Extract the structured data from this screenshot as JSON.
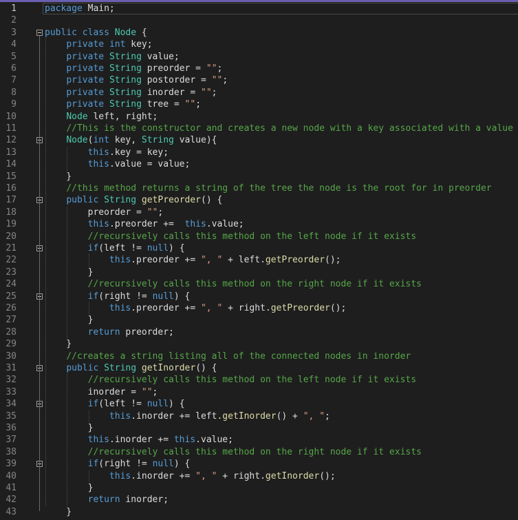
{
  "editor": {
    "current_line": 1,
    "lines": [
      {
        "n": "1",
        "fold": false,
        "tokens": [
          [
            "k",
            "package"
          ],
          [
            "p",
            " Main;"
          ]
        ]
      },
      {
        "n": "2",
        "fold": false,
        "tokens": []
      },
      {
        "n": "3",
        "fold": true,
        "tokens": [
          [
            "k",
            "public"
          ],
          [
            "p",
            " "
          ],
          [
            "k",
            "class"
          ],
          [
            "p",
            " "
          ],
          [
            "t",
            "Node"
          ],
          [
            "p",
            " {"
          ]
        ]
      },
      {
        "n": "4",
        "fold": false,
        "tokens": [
          [
            "p",
            "    "
          ],
          [
            "k",
            "private"
          ],
          [
            "p",
            " "
          ],
          [
            "k",
            "int"
          ],
          [
            "p",
            " key;"
          ]
        ]
      },
      {
        "n": "5",
        "fold": false,
        "tokens": [
          [
            "p",
            "    "
          ],
          [
            "k",
            "private"
          ],
          [
            "p",
            " "
          ],
          [
            "t",
            "String"
          ],
          [
            "p",
            " value;"
          ]
        ]
      },
      {
        "n": "6",
        "fold": false,
        "tokens": [
          [
            "p",
            "    "
          ],
          [
            "k",
            "private"
          ],
          [
            "p",
            " "
          ],
          [
            "t",
            "String"
          ],
          [
            "p",
            " preorder = "
          ],
          [
            "s",
            "\"\""
          ],
          [
            "p",
            ";"
          ]
        ]
      },
      {
        "n": "7",
        "fold": false,
        "tokens": [
          [
            "p",
            "    "
          ],
          [
            "k",
            "private"
          ],
          [
            "p",
            " "
          ],
          [
            "t",
            "String"
          ],
          [
            "p",
            " postorder = "
          ],
          [
            "s",
            "\"\""
          ],
          [
            "p",
            ";"
          ]
        ]
      },
      {
        "n": "8",
        "fold": false,
        "tokens": [
          [
            "p",
            "    "
          ],
          [
            "k",
            "private"
          ],
          [
            "p",
            " "
          ],
          [
            "t",
            "String"
          ],
          [
            "p",
            " inorder = "
          ],
          [
            "s",
            "\"\""
          ],
          [
            "p",
            ";"
          ]
        ]
      },
      {
        "n": "9",
        "fold": false,
        "tokens": [
          [
            "p",
            "    "
          ],
          [
            "k",
            "private"
          ],
          [
            "p",
            " "
          ],
          [
            "t",
            "String"
          ],
          [
            "p",
            " tree = "
          ],
          [
            "s",
            "\"\""
          ],
          [
            "p",
            ";"
          ]
        ]
      },
      {
        "n": "10",
        "fold": false,
        "tokens": [
          [
            "p",
            "    "
          ],
          [
            "t",
            "Node"
          ],
          [
            "p",
            " left, right;"
          ]
        ]
      },
      {
        "n": "11",
        "fold": false,
        "tokens": [
          [
            "p",
            "    "
          ],
          [
            "c",
            "//This is the constructor and creates a new node with a key associated with a value"
          ]
        ]
      },
      {
        "n": "12",
        "fold": true,
        "tokens": [
          [
            "p",
            "    "
          ],
          [
            "t",
            "Node"
          ],
          [
            "p",
            "("
          ],
          [
            "k",
            "int"
          ],
          [
            "p",
            " key, "
          ],
          [
            "t",
            "String"
          ],
          [
            "p",
            " value){"
          ]
        ]
      },
      {
        "n": "13",
        "fold": false,
        "tokens": [
          [
            "p",
            "        "
          ],
          [
            "k",
            "this"
          ],
          [
            "p",
            ".key = key;"
          ]
        ]
      },
      {
        "n": "14",
        "fold": false,
        "tokens": [
          [
            "p",
            "        "
          ],
          [
            "k",
            "this"
          ],
          [
            "p",
            ".value = value;"
          ]
        ]
      },
      {
        "n": "15",
        "fold": false,
        "tokens": [
          [
            "p",
            "    }"
          ]
        ]
      },
      {
        "n": "16",
        "fold": false,
        "tokens": [
          [
            "p",
            "    "
          ],
          [
            "c",
            "//this method returns a string of the tree the node is the root for in preorder"
          ]
        ]
      },
      {
        "n": "17",
        "fold": true,
        "tokens": [
          [
            "p",
            "    "
          ],
          [
            "k",
            "public"
          ],
          [
            "p",
            " "
          ],
          [
            "t",
            "String"
          ],
          [
            "p",
            " "
          ],
          [
            "m",
            "getPreorder"
          ],
          [
            "p",
            "() {"
          ]
        ]
      },
      {
        "n": "18",
        "fold": false,
        "tokens": [
          [
            "p",
            "        preorder = "
          ],
          [
            "s",
            "\"\""
          ],
          [
            "p",
            ";"
          ]
        ]
      },
      {
        "n": "19",
        "fold": false,
        "tokens": [
          [
            "p",
            "        "
          ],
          [
            "k",
            "this"
          ],
          [
            "p",
            ".preorder +=  "
          ],
          [
            "k",
            "this"
          ],
          [
            "p",
            ".value;"
          ]
        ]
      },
      {
        "n": "20",
        "fold": false,
        "tokens": [
          [
            "p",
            "        "
          ],
          [
            "c",
            "//recursively calls this method on the left node if it exists"
          ]
        ]
      },
      {
        "n": "21",
        "fold": true,
        "tokens": [
          [
            "p",
            "        "
          ],
          [
            "k",
            "if"
          ],
          [
            "p",
            "(left != "
          ],
          [
            "k",
            "null"
          ],
          [
            "p",
            ") {"
          ]
        ]
      },
      {
        "n": "22",
        "fold": false,
        "tokens": [
          [
            "p",
            "            "
          ],
          [
            "k",
            "this"
          ],
          [
            "p",
            ".preorder += "
          ],
          [
            "s",
            "\", \""
          ],
          [
            "p",
            " + left."
          ],
          [
            "m",
            "getPreorder"
          ],
          [
            "p",
            "();"
          ]
        ]
      },
      {
        "n": "23",
        "fold": false,
        "tokens": [
          [
            "p",
            "        }"
          ]
        ]
      },
      {
        "n": "24",
        "fold": false,
        "tokens": [
          [
            "p",
            "        "
          ],
          [
            "c",
            "//recursively calls this method on the right node if it exists"
          ]
        ]
      },
      {
        "n": "25",
        "fold": true,
        "tokens": [
          [
            "p",
            "        "
          ],
          [
            "k",
            "if"
          ],
          [
            "p",
            "(right != "
          ],
          [
            "k",
            "null"
          ],
          [
            "p",
            ") {"
          ]
        ]
      },
      {
        "n": "26",
        "fold": false,
        "tokens": [
          [
            "p",
            "            "
          ],
          [
            "k",
            "this"
          ],
          [
            "p",
            ".preorder += "
          ],
          [
            "s",
            "\", \""
          ],
          [
            "p",
            " + right."
          ],
          [
            "m",
            "getPreorder"
          ],
          [
            "p",
            "();"
          ]
        ]
      },
      {
        "n": "27",
        "fold": false,
        "tokens": [
          [
            "p",
            "        }"
          ]
        ]
      },
      {
        "n": "28",
        "fold": false,
        "tokens": [
          [
            "p",
            "        "
          ],
          [
            "k",
            "return"
          ],
          [
            "p",
            " preorder;"
          ]
        ]
      },
      {
        "n": "29",
        "fold": false,
        "tokens": [
          [
            "p",
            "    }"
          ]
        ]
      },
      {
        "n": "30",
        "fold": false,
        "tokens": [
          [
            "p",
            "    "
          ],
          [
            "c",
            "//creates a string listing all of the connected nodes in inorder"
          ]
        ]
      },
      {
        "n": "31",
        "fold": true,
        "tokens": [
          [
            "p",
            "    "
          ],
          [
            "k",
            "public"
          ],
          [
            "p",
            " "
          ],
          [
            "t",
            "String"
          ],
          [
            "p",
            " "
          ],
          [
            "m",
            "getInorder"
          ],
          [
            "p",
            "() {"
          ]
        ]
      },
      {
        "n": "32",
        "fold": false,
        "tokens": [
          [
            "p",
            "        "
          ],
          [
            "c",
            "//recursively calls this method on the left node if it exists"
          ]
        ]
      },
      {
        "n": "33",
        "fold": false,
        "tokens": [
          [
            "p",
            "        inorder = "
          ],
          [
            "s",
            "\"\""
          ],
          [
            "p",
            ";"
          ]
        ]
      },
      {
        "n": "34",
        "fold": true,
        "tokens": [
          [
            "p",
            "        "
          ],
          [
            "k",
            "if"
          ],
          [
            "p",
            "(left != "
          ],
          [
            "k",
            "null"
          ],
          [
            "p",
            ") {"
          ]
        ]
      },
      {
        "n": "35",
        "fold": false,
        "tokens": [
          [
            "p",
            "            "
          ],
          [
            "k",
            "this"
          ],
          [
            "p",
            ".inorder += left."
          ],
          [
            "m",
            "getInorder"
          ],
          [
            "p",
            "() + "
          ],
          [
            "s",
            "\", \""
          ],
          [
            "p",
            ";"
          ]
        ]
      },
      {
        "n": "36",
        "fold": false,
        "tokens": [
          [
            "p",
            "        }"
          ]
        ]
      },
      {
        "n": "37",
        "fold": false,
        "tokens": [
          [
            "p",
            "        "
          ],
          [
            "k",
            "this"
          ],
          [
            "p",
            ".inorder += "
          ],
          [
            "k",
            "this"
          ],
          [
            "p",
            ".value;"
          ]
        ]
      },
      {
        "n": "38",
        "fold": false,
        "tokens": [
          [
            "p",
            "        "
          ],
          [
            "c",
            "//recursively calls this method on the right node if it exists"
          ]
        ]
      },
      {
        "n": "39",
        "fold": true,
        "tokens": [
          [
            "p",
            "        "
          ],
          [
            "k",
            "if"
          ],
          [
            "p",
            "(right != "
          ],
          [
            "k",
            "null"
          ],
          [
            "p",
            ") {"
          ]
        ]
      },
      {
        "n": "40",
        "fold": false,
        "tokens": [
          [
            "p",
            "            "
          ],
          [
            "k",
            "this"
          ],
          [
            "p",
            ".inorder += "
          ],
          [
            "s",
            "\", \""
          ],
          [
            "p",
            " + right."
          ],
          [
            "m",
            "getInorder"
          ],
          [
            "p",
            "();"
          ]
        ]
      },
      {
        "n": "41",
        "fold": false,
        "tokens": [
          [
            "p",
            "        }"
          ]
        ]
      },
      {
        "n": "42",
        "fold": false,
        "tokens": [
          [
            "p",
            "        "
          ],
          [
            "k",
            "return"
          ],
          [
            "p",
            " inorder;"
          ]
        ]
      },
      {
        "n": "43",
        "fold": false,
        "tokens": [
          [
            "p",
            "    }"
          ]
        ]
      }
    ]
  }
}
